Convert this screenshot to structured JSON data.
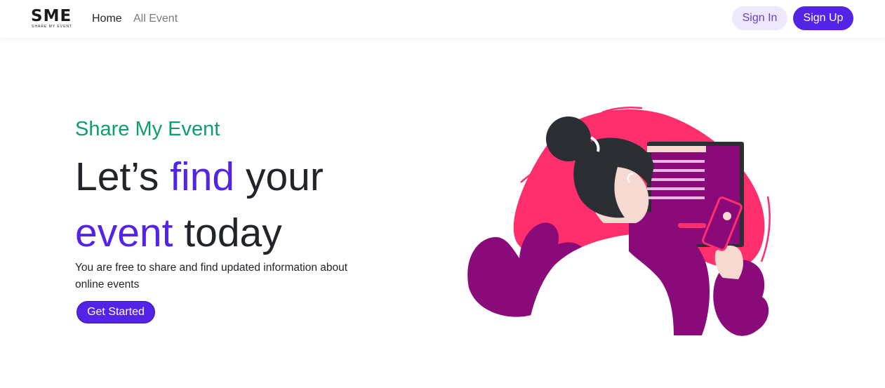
{
  "nav": {
    "logo_text": "SME",
    "logo_tagline": "SHARE MY EVENT",
    "links": [
      {
        "label": "Home"
      },
      {
        "label": "All Event"
      }
    ],
    "signin_label": "Sign In",
    "signup_label": "Sign Up"
  },
  "hero": {
    "eyebrow": "Share My Event",
    "headline_part1": "Let’s ",
    "headline_accent1": "find",
    "headline_part2": " your",
    "headline_accent2": "event",
    "headline_part3": " today",
    "description": "You are free to share and find updated information about online events",
    "cta_label": "Get Started"
  },
  "colors": {
    "primary": "#5424e6",
    "eyebrow": "#0f9d6e",
    "illustration_pink": "#ff2f6e",
    "illustration_purple": "#8a0a7a"
  }
}
